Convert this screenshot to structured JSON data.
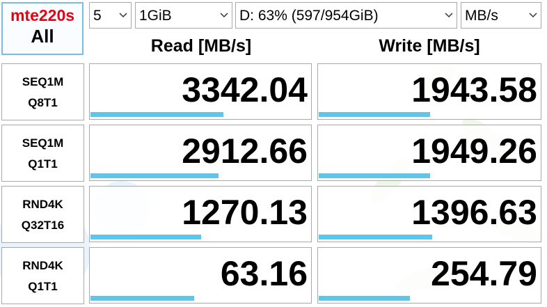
{
  "all_button": {
    "line1": "mte220s",
    "line2": "All"
  },
  "controls": {
    "count": "5",
    "size": "1GiB",
    "drive": "D: 63% (597/954GiB)",
    "unit": "MB/s"
  },
  "headers": {
    "read": "Read [MB/s]",
    "write": "Write [MB/s]"
  },
  "rows": [
    {
      "label1": "SEQ1M",
      "label2": "Q8T1",
      "read": "3342.04",
      "write": "1943.58",
      "read_fill": 0.6,
      "write_fill": 0.5
    },
    {
      "label1": "SEQ1M",
      "label2": "Q1T1",
      "read": "2912.66",
      "write": "1949.26",
      "read_fill": 0.58,
      "write_fill": 0.5
    },
    {
      "label1": "RND4K",
      "label2": "Q32T16",
      "read": "1270.13",
      "write": "1396.63",
      "read_fill": 0.5,
      "write_fill": 0.51
    },
    {
      "label1": "RND4K",
      "label2": "Q1T1",
      "read": "63.16",
      "write": "254.79",
      "read_fill": 0.47,
      "write_fill": 0.41
    }
  ],
  "colors": {
    "bar": "#5ac8ee",
    "accent_red": "#e60012",
    "border": "#a8a8a8"
  },
  "icons": {
    "dropdown": "chevron-down-icon",
    "background": "leaf-pattern-decoration"
  }
}
